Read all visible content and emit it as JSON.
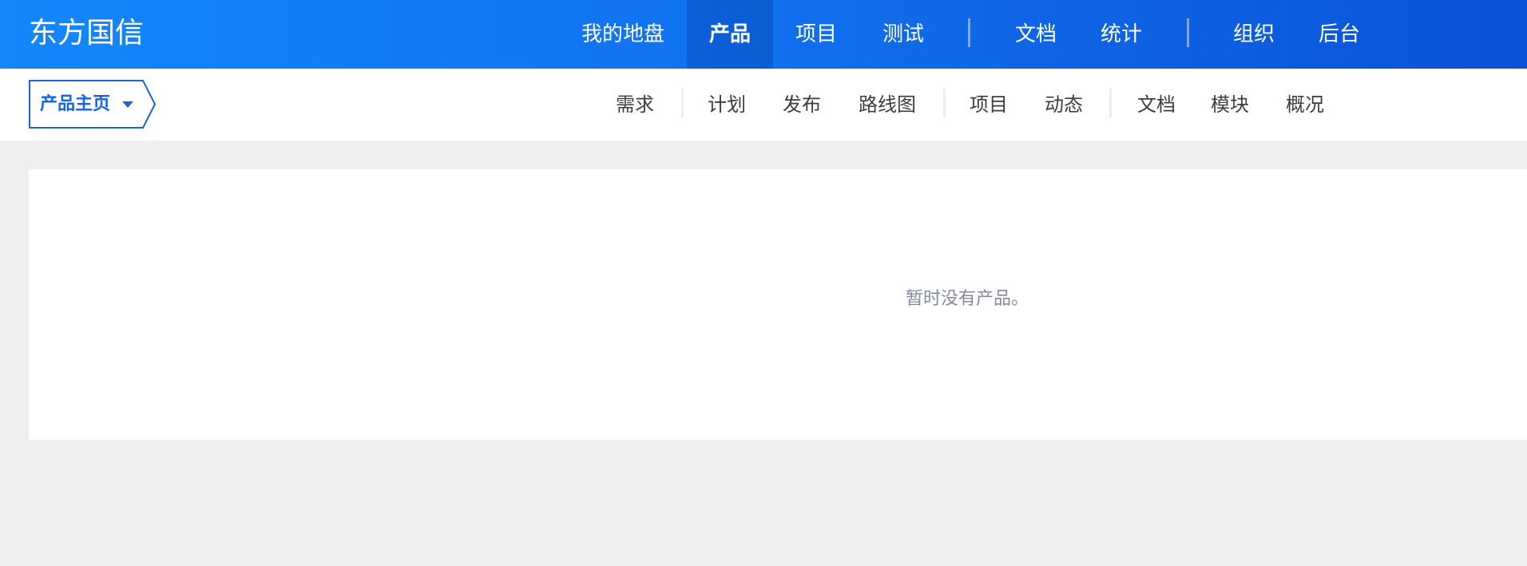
{
  "header": {
    "logo": "东方国信",
    "nav": [
      "我的地盘",
      "产品",
      "项目",
      "测试",
      "文档",
      "统计",
      "组织",
      "后台"
    ],
    "active": "产品"
  },
  "subnav": {
    "home_label": "产品主页",
    "items": [
      "需求",
      "计划",
      "发布",
      "路线图",
      "项目",
      "动态",
      "文档",
      "模块",
      "概况"
    ]
  },
  "main": {
    "empty_text": "暂时没有产品。"
  },
  "colors": {
    "accent": "#1565e0",
    "header_start": "#1487fb",
    "header_end": "#0b52d8"
  }
}
